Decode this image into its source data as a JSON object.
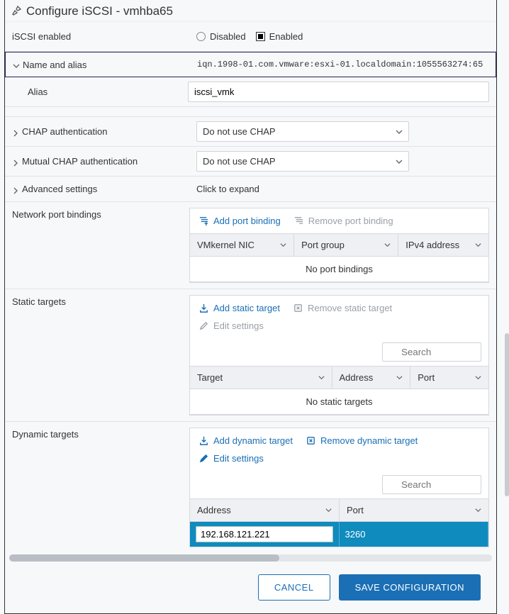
{
  "title": "Configure iSCSI - vmhba65",
  "iscsi_enabled": {
    "label": "iSCSI enabled",
    "disabled_label": "Disabled",
    "enabled_label": "Enabled",
    "value": "Enabled"
  },
  "name_alias": {
    "label": "Name and alias",
    "iqn": "iqn.1998-01.com.vmware:esxi-01.localdomain:1055563274:65",
    "alias_label": "Alias",
    "alias_value": "iscsi_vmk"
  },
  "chap": {
    "label": "CHAP authentication",
    "value": "Do not use CHAP"
  },
  "mutual_chap": {
    "label": "Mutual CHAP authentication",
    "value": "Do not use CHAP"
  },
  "advanced": {
    "label": "Advanced settings",
    "hint": "Click to expand"
  },
  "port_bindings": {
    "label": "Network port bindings",
    "add": "Add port binding",
    "remove": "Remove port binding",
    "cols": [
      "VMkernel NIC",
      "Port group",
      "IPv4 address"
    ],
    "empty": "No port bindings"
  },
  "static_targets": {
    "label": "Static targets",
    "add": "Add static target",
    "remove": "Remove static target",
    "edit": "Edit settings",
    "search_placeholder": "Search",
    "cols": [
      "Target",
      "Address",
      "Port"
    ],
    "empty": "No static targets"
  },
  "dynamic_targets": {
    "label": "Dynamic targets",
    "add": "Add dynamic target",
    "remove": "Remove dynamic target",
    "edit": "Edit settings",
    "search_placeholder": "Search",
    "cols": [
      "Address",
      "Port"
    ],
    "row": {
      "address": "192.168.121.221",
      "port": "3260"
    }
  },
  "footer": {
    "cancel": "CANCEL",
    "save": "SAVE CONFIGURATION"
  },
  "chart_data": null
}
